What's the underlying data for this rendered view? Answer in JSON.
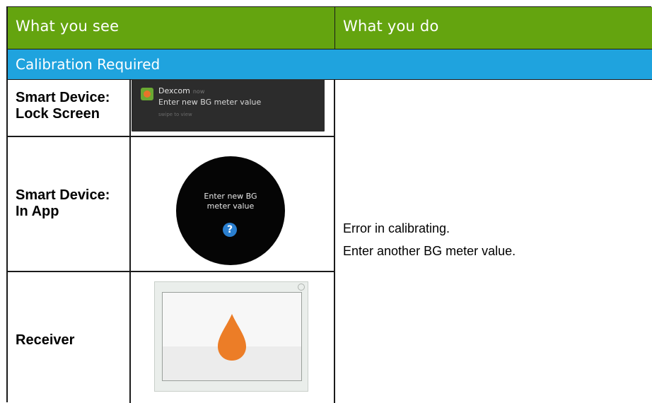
{
  "header": {
    "col1": "What you see",
    "col2": "What you do"
  },
  "section": {
    "title": "Calibration Required"
  },
  "rows": [
    {
      "label_line1": "Smart Device:",
      "label_line2": "Lock Screen"
    },
    {
      "label_line1": "Smart Device:",
      "label_line2": "In App"
    },
    {
      "label_line1": "Receiver"
    }
  ],
  "lock_screen": {
    "app_name": "Dexcom",
    "app_meta": "now",
    "message": "Enter new BG meter value",
    "hint": "swipe to view"
  },
  "watch": {
    "line1": "Enter new BG",
    "line2": "meter value",
    "help_glyph": "?"
  },
  "action": {
    "line1": "Error in calibrating.",
    "line2": "Enter another BG meter value."
  },
  "colors": {
    "header": "#64a40f",
    "section": "#1fa3de",
    "drop": "#ec7d27"
  },
  "icons": {
    "receiver": "blood-drop-icon",
    "help": "question-icon",
    "app": "dexcom-app-icon"
  }
}
